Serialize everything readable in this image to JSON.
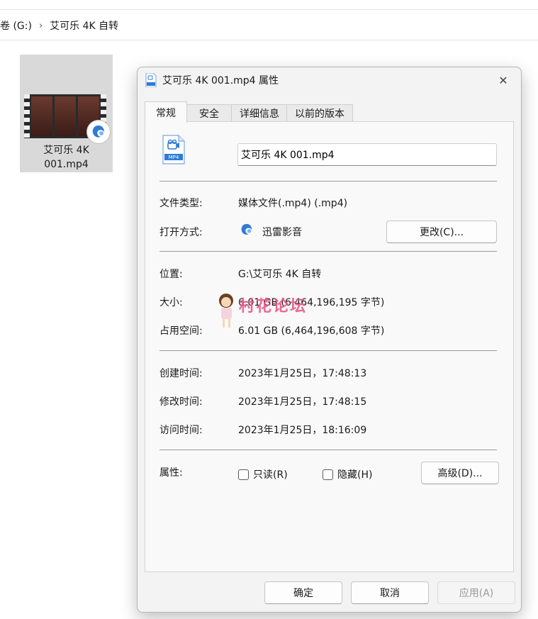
{
  "explorer": {
    "breadcrumb": {
      "drive": "卷 (G:)",
      "folder": "艾可乐 4K 自转"
    },
    "file": {
      "name": "艾可乐 4K\n001.mp4"
    }
  },
  "dialog": {
    "title": "艾可乐 4K 001.mp4 属性",
    "tabs": [
      "常规",
      "安全",
      "详细信息",
      "以前的版本"
    ],
    "file_icon_label": "MP4",
    "filename_value": "艾可乐 4K 001.mp4",
    "rows": {
      "type_label": "文件类型:",
      "type_value": "媒体文件(.mp4) (.mp4)",
      "opens_label": "打开方式:",
      "opens_value": "迅雷影音",
      "change_button": "更改(C)...",
      "location_label": "位置:",
      "location_value": "G:\\艾可乐 4K 自转",
      "size_label": "大小:",
      "size_value": "6.01 GB (6,464,196,195 字节)",
      "disk_label": "占用空间:",
      "disk_value": "6.01 GB (6,464,196,608 字节)",
      "created_label": "创建时间:",
      "created_value": "2023年1月25日，17:48:13",
      "modified_label": "修改时间:",
      "modified_value": "2023年1月25日，17:48:15",
      "accessed_label": "访问时间:",
      "accessed_value": "2023年1月25日，18:16:09",
      "attrs_label": "属性:",
      "readonly_label": "只读(R)",
      "hidden_label": "隐藏(H)",
      "advanced_button": "高级(D)..."
    },
    "footer": {
      "ok": "确定",
      "cancel": "取消",
      "apply": "应用(A)"
    }
  },
  "watermark": {
    "text": "村花论坛"
  },
  "colors": {
    "accent": "#2f7bd6",
    "watermark": "#e85a8a"
  }
}
